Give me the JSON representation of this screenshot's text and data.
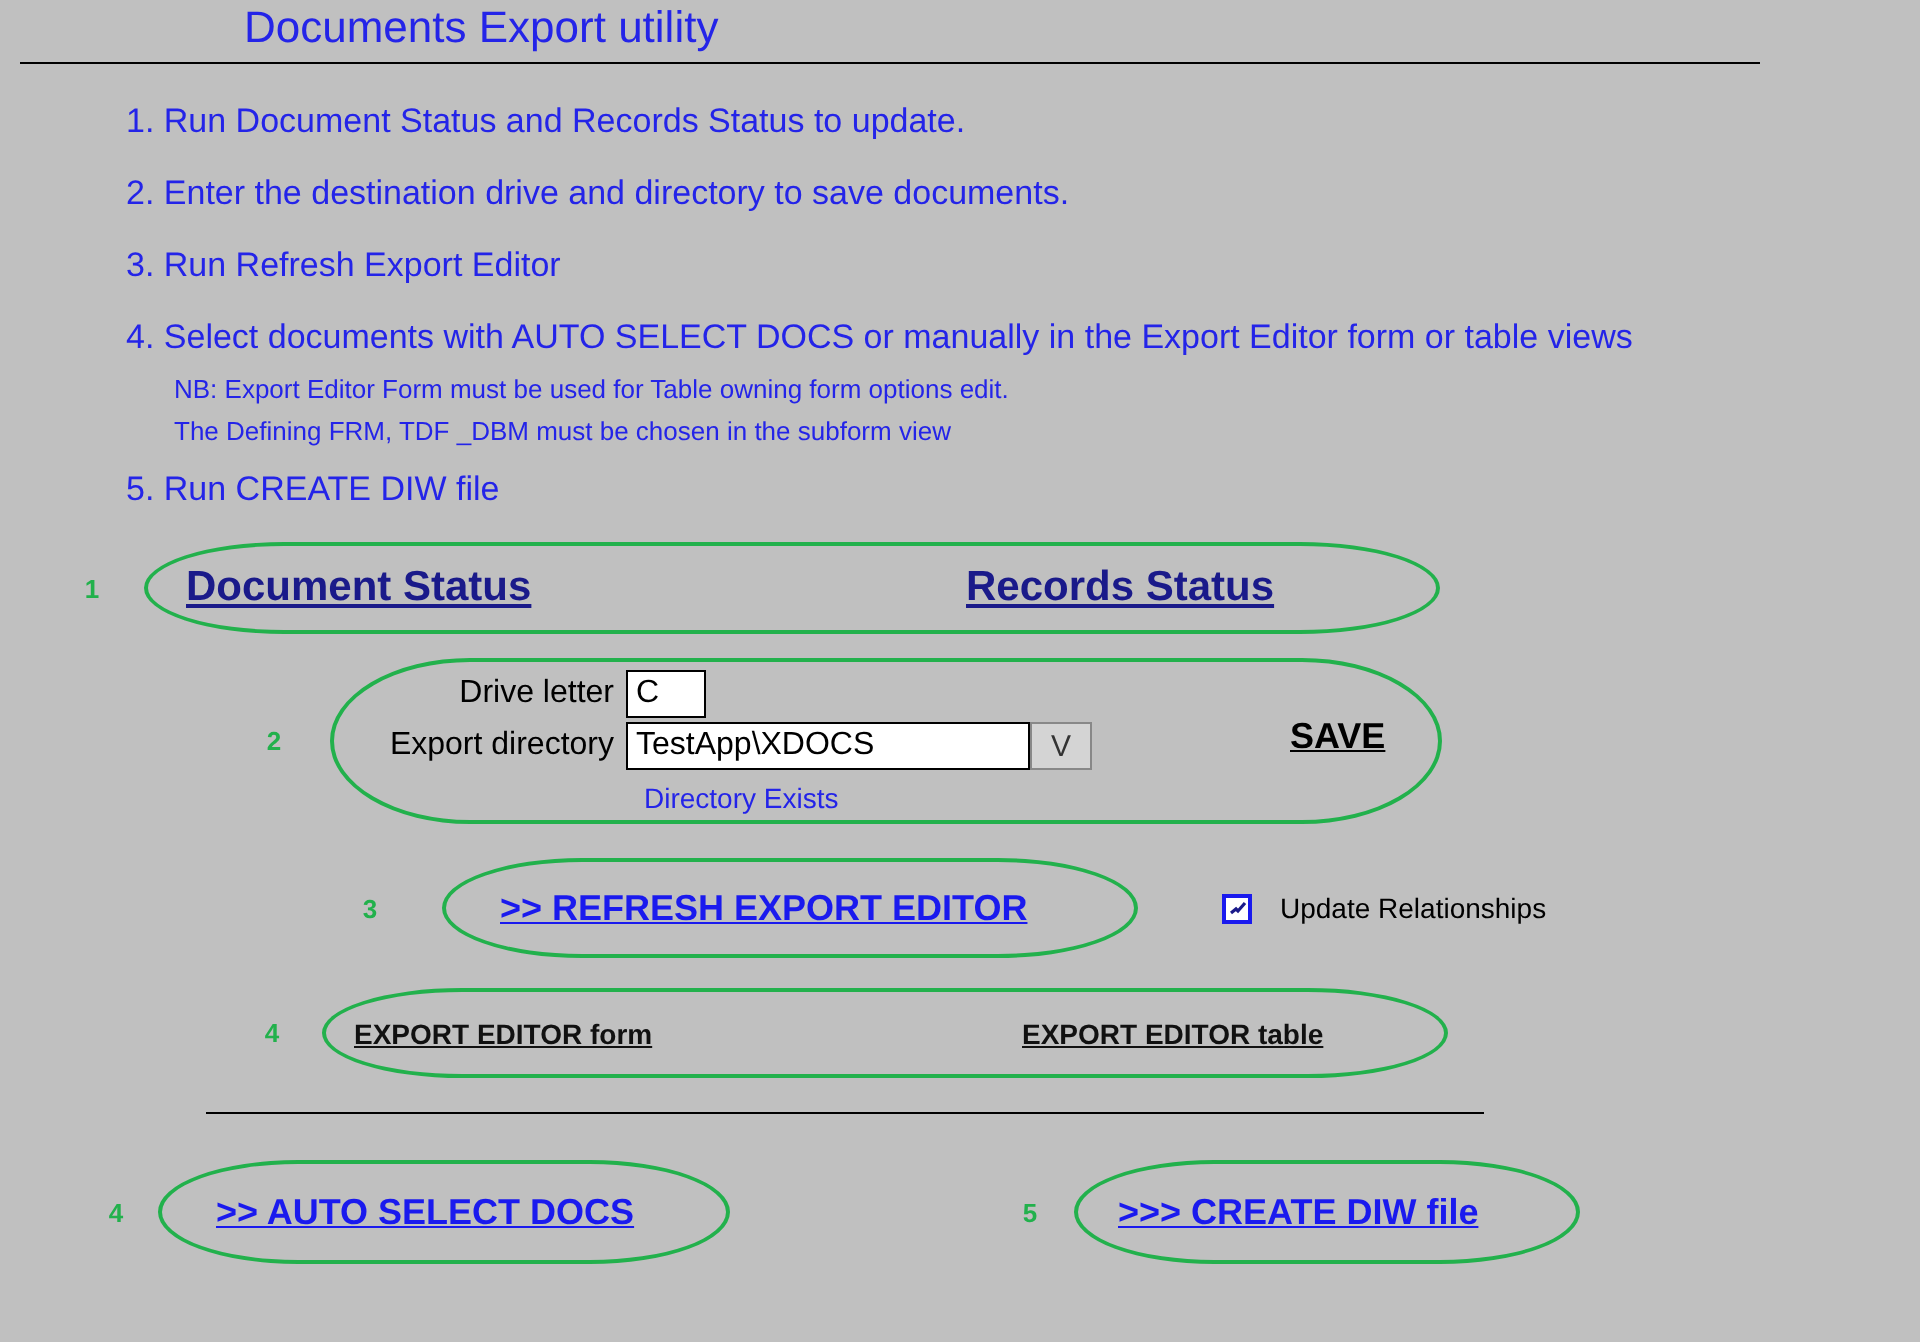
{
  "title": "Documents Export utility",
  "steps": [
    {
      "text": "1. Run Document Status and Records Status to update."
    },
    {
      "text": "2. Enter the destination drive and directory to save documents."
    },
    {
      "text": "3. Run Refresh Export Editor"
    },
    {
      "text": "4. Select documents with AUTO SELECT DOCS or manually in the Export Editor form or table views",
      "notes": [
        "NB: Export Editor Form must be used for Table owning form options edit.",
        "The Defining FRM, TDF _DBM must be chosen in the subform view"
      ]
    },
    {
      "text": "5. Run CREATE DIW file"
    }
  ],
  "status_links": {
    "marker": "1",
    "links": [
      "Document Status",
      "Records Status"
    ]
  },
  "export_settings": {
    "marker": "2",
    "drive_letter": {
      "label": "Drive letter",
      "value": "C"
    },
    "export_directory": {
      "label": "Export directory",
      "value": "TestApp\\XDOCS",
      "dropdown_button": "V"
    },
    "status": "Directory Exists",
    "save": "SAVE"
  },
  "refresh": {
    "marker": "3",
    "link": ">> REFRESH EXPORT EDITOR",
    "update_relationships": {
      "label": "Update Relationships",
      "checked": true
    }
  },
  "editor_links": {
    "marker": "4",
    "links": [
      "EXPORT EDITOR form",
      "EXPORT EDITOR table"
    ]
  },
  "actions": [
    {
      "marker": "4",
      "link": ">> AUTO SELECT DOCS"
    },
    {
      "marker": "5",
      "link": ">>> CREATE DIW file"
    }
  ]
}
